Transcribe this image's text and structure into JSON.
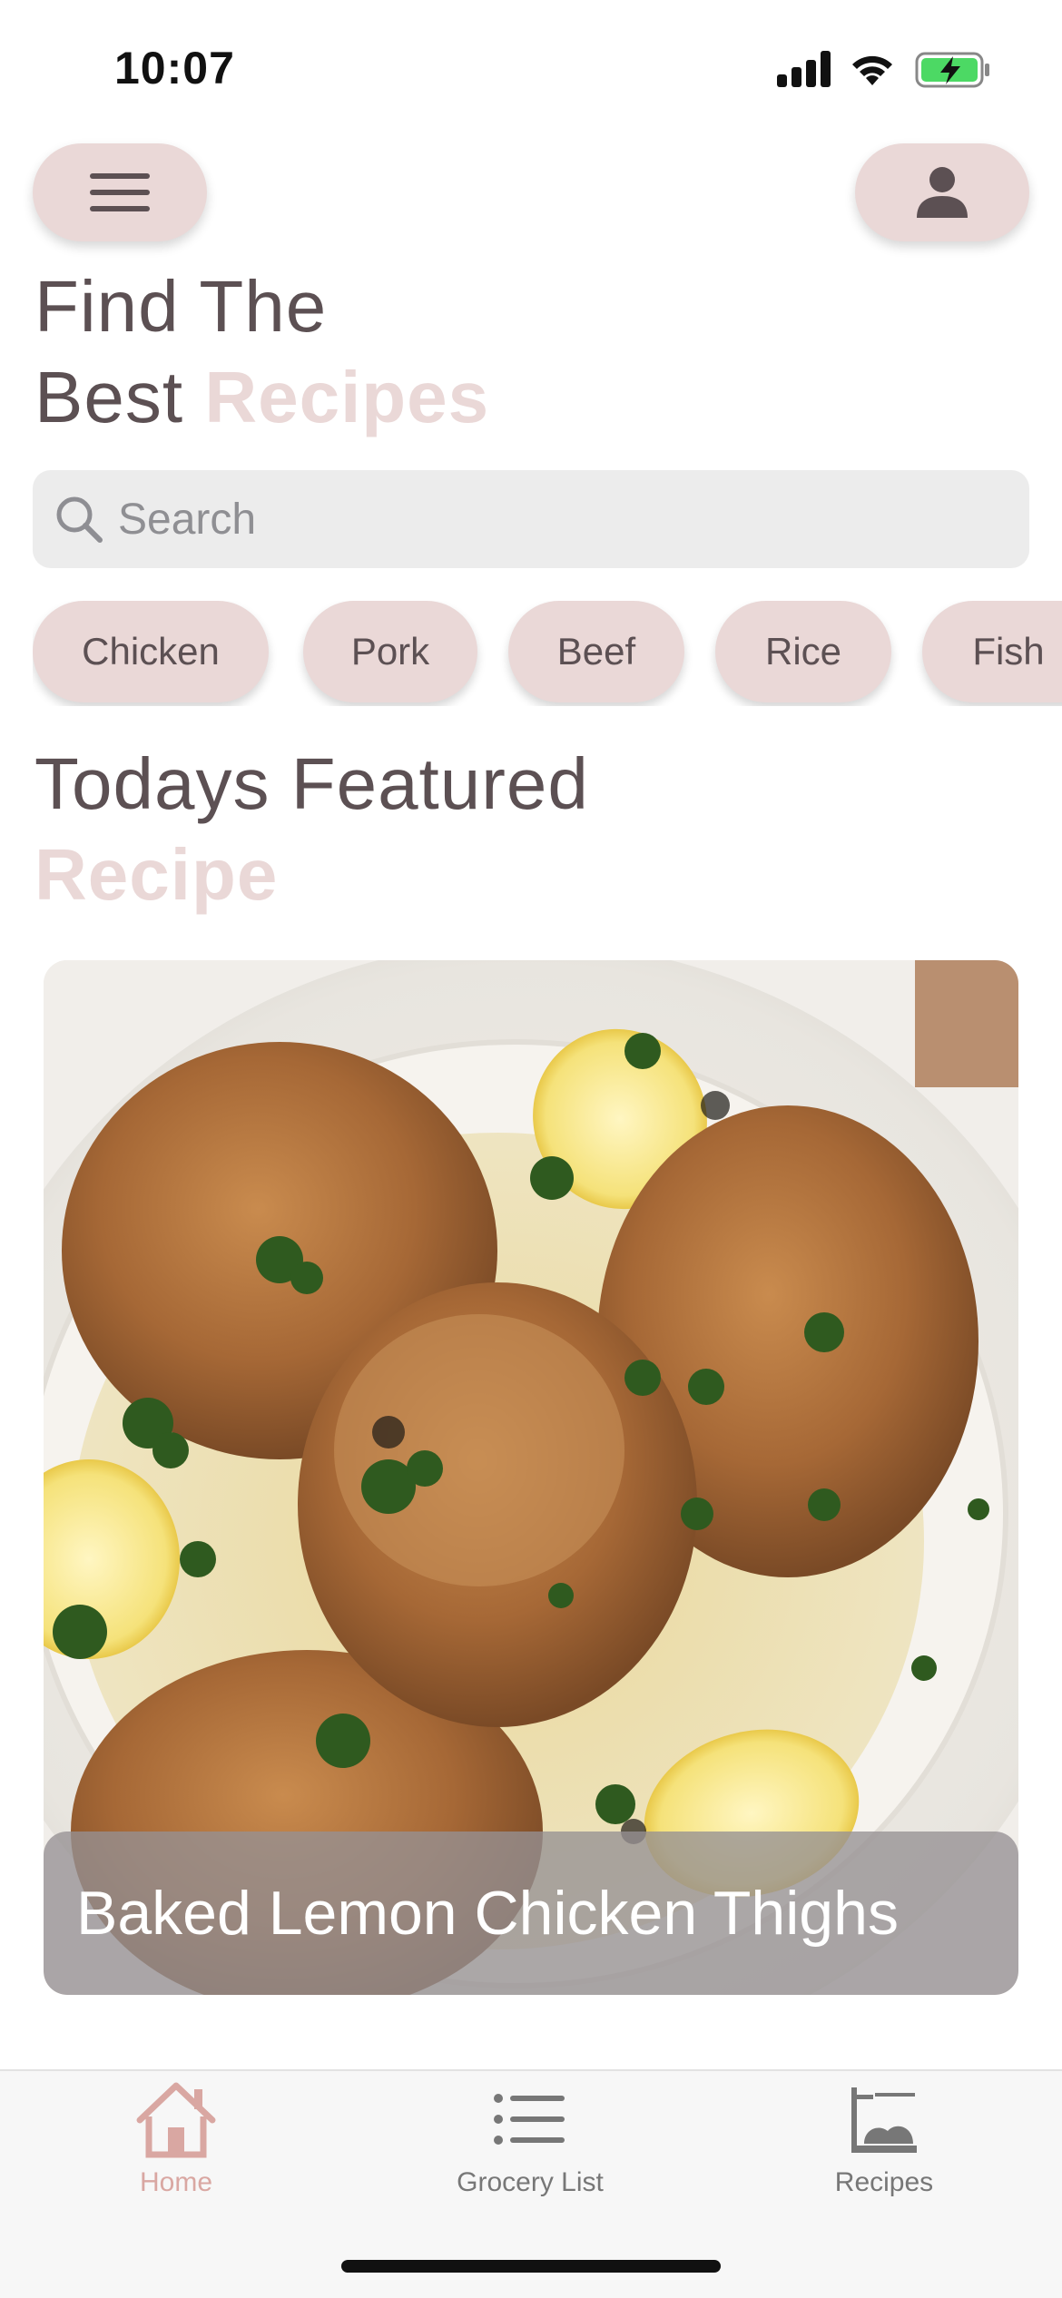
{
  "status_bar": {
    "time": "10:07"
  },
  "header": {
    "menu_icon": "hamburger-icon",
    "profile_icon": "person-icon",
    "title_line1": "Find The",
    "title_line2_plain": "Best ",
    "title_line2_accent": "Recipes"
  },
  "search": {
    "placeholder": "Search",
    "icon": "search-icon"
  },
  "categories": [
    "Chicken",
    "Pork",
    "Beef",
    "Rice",
    "Fish"
  ],
  "featured": {
    "title_line1": "Todays Featured",
    "title_line2": "Recipe",
    "recipe_name": "Baked Lemon Chicken Thighs"
  },
  "tabbar": {
    "items": [
      {
        "label": "Home",
        "icon": "home-icon",
        "active": true
      },
      {
        "label": "Grocery List",
        "icon": "list-icon",
        "active": false
      },
      {
        "label": "Recipes",
        "icon": "stove-icon",
        "active": false
      }
    ]
  },
  "colors": {
    "accent": "#ead8d7",
    "text": "#5c5053",
    "active_tab": "#d9a7a2",
    "inactive_tab": "#777777",
    "battery": "#4cd964"
  }
}
